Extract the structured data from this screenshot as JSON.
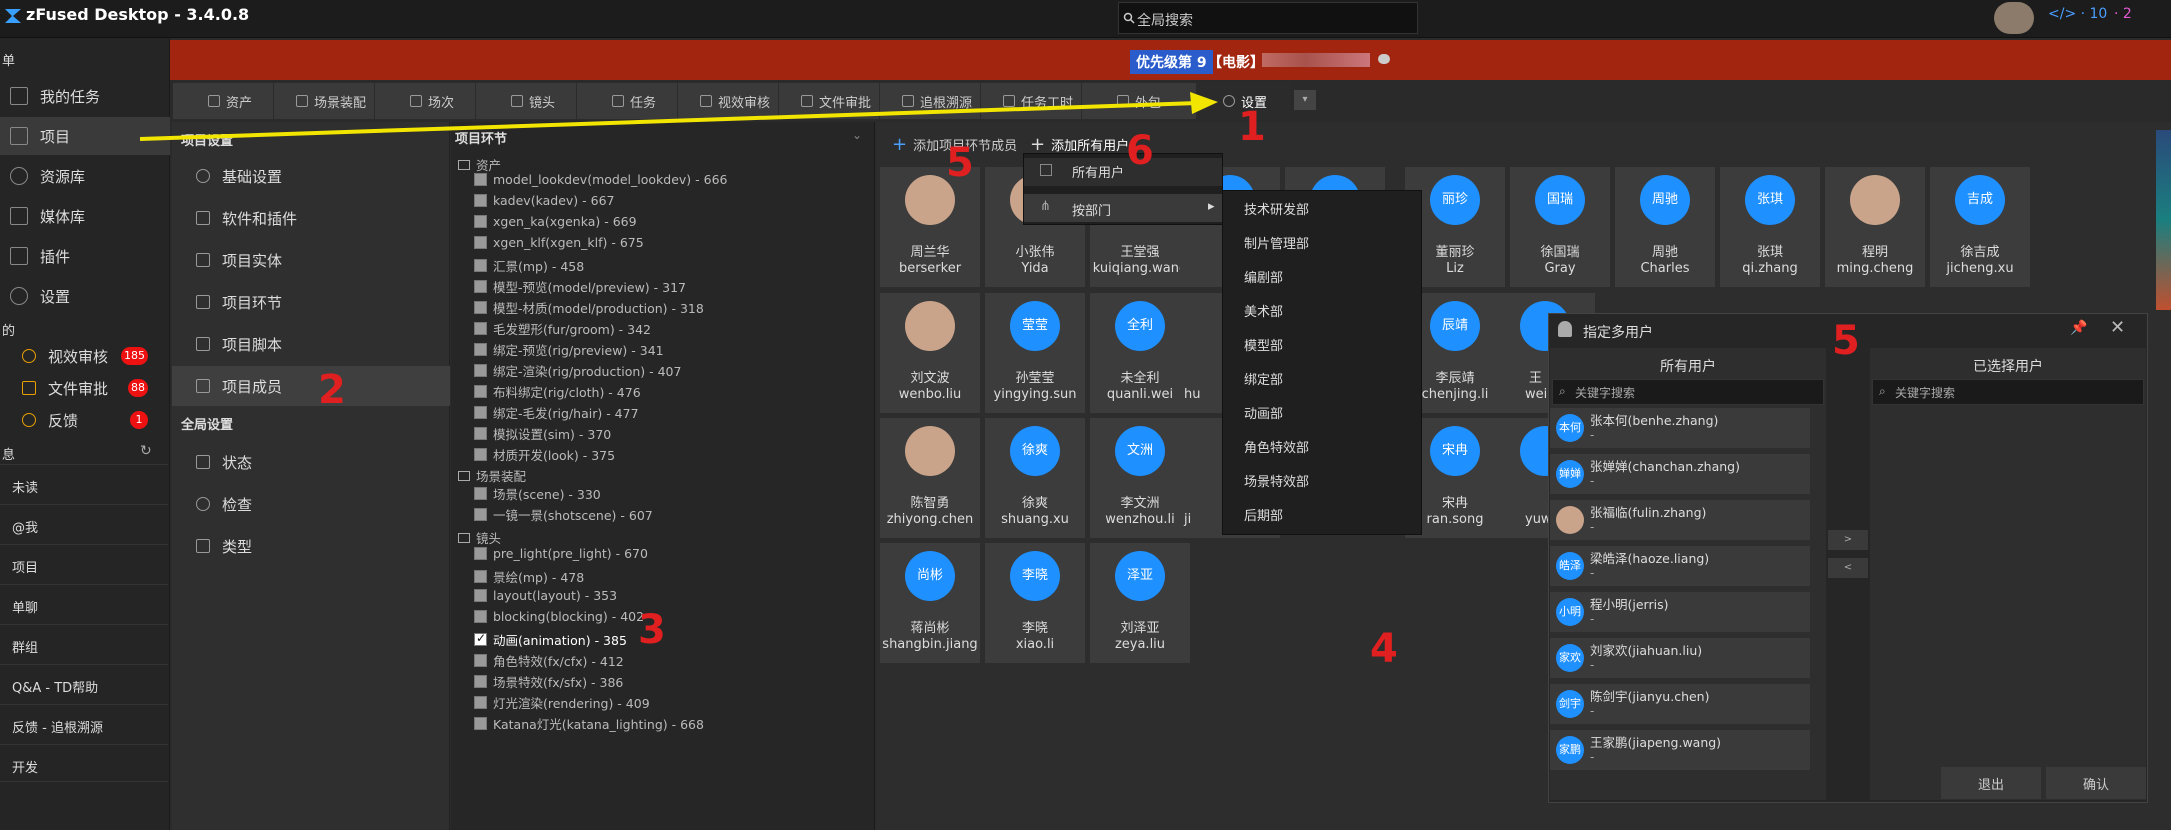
{
  "app": {
    "title": "zFused Desktop - 3.4.0.8",
    "search_placeholder": "全局搜索",
    "code_count": "</> · 10",
    "git_count": "· 2"
  },
  "banner": {
    "priority": "优先级第 9",
    "film_prefix": "【电影】"
  },
  "leftnav": {
    "section_menu": "单",
    "items": [
      {
        "label": "我的任务"
      },
      {
        "label": "项目"
      },
      {
        "label": "资源库"
      },
      {
        "label": "媒体库"
      },
      {
        "label": "插件"
      },
      {
        "label": "设置"
      }
    ],
    "section_mine": "的",
    "review": [
      {
        "label": "视效审核",
        "badge": "185"
      },
      {
        "label": "文件审批",
        "badge": "88"
      },
      {
        "label": "反馈",
        "badge": "1"
      }
    ],
    "section_msg": "息",
    "messages": [
      "未读",
      "@我",
      "项目",
      "单聊",
      "群组",
      "Q&A - TD帮助",
      "反馈 - 追根溯源",
      "开发"
    ]
  },
  "tabs": [
    "资产",
    "场景装配",
    "场次",
    "镜头",
    "任务",
    "视效审核",
    "文件审批",
    "追根溯源",
    "任务工时",
    "外包",
    "设置"
  ],
  "projcol": {
    "title": "项目设置",
    "items": [
      "基础设置",
      "软件和插件",
      "项目实体",
      "项目环节",
      "项目脚本",
      "项目成员"
    ],
    "global_title": "全局设置",
    "global_items": [
      "状态",
      "检查",
      "类型"
    ]
  },
  "steps": {
    "title": "项目环节",
    "group_asset": "资产",
    "asset_steps": [
      "model_lookdev(model_lookdev) - 666",
      "kadev(kadev) - 667",
      "xgen_ka(xgenka) - 669",
      "xgen_klf(xgen_klf) - 675",
      "汇景(mp) - 458",
      "模型-预览(model/preview) - 317",
      "模型-材质(model/production) - 318",
      "毛发塑形(fur/groom) - 342",
      "绑定-预览(rig/preview) - 341",
      "绑定-渲染(rig/production) - 407",
      "布料绑定(rig/cloth) - 476",
      "绑定-毛发(rig/hair) - 477",
      "模拟设置(sim) - 370",
      "材质开发(look) - 375"
    ],
    "group_scene": "场景装配",
    "scene_steps": [
      "场景(scene) - 330",
      "一镜一景(shotscene) - 607"
    ],
    "group_shot": "镜头",
    "shot_steps": [
      "pre_light(pre_light) - 670",
      "景绘(mp) - 478",
      "layout(layout) - 353",
      "blocking(blocking) - 402",
      "动画(animation) - 385",
      "角色特效(fx/cfx) - 412",
      "场景特效(fx/sfx) - 386",
      "灯光渲染(rendering) - 409",
      "Katana灯光(katana_lighting) - 668"
    ],
    "checked": "动画(animation) - 385"
  },
  "members_toolbar": {
    "add_step_member": "添加项目环节成员",
    "add_all_users": "添加所有用户"
  },
  "members": [
    {
      "cn": "周兰华",
      "en": "berserker",
      "avatar": "photo"
    },
    {
      "cn": "小张伟",
      "en": "Yida",
      "avatar": "photo"
    },
    {
      "cn": "王堂强",
      "en": "kuiqiang.wang",
      "avatar": "photo"
    },
    {
      "cn": "董丽珍",
      "en": "Liz",
      "avatar": "丽珍"
    },
    {
      "cn": "徐国瑞",
      "en": "Gray",
      "avatar": "国瑞"
    },
    {
      "cn": "周驰",
      "en": "Charles",
      "avatar": "周驰"
    },
    {
      "cn": "张琪",
      "en": "qi.zhang",
      "avatar": "张琪"
    },
    {
      "cn": "程明",
      "en": "ming.cheng",
      "avatar": "photo"
    },
    {
      "cn": "徐吉成",
      "en": "jicheng.xu",
      "avatar": "吉成"
    },
    {
      "cn": "刘文波",
      "en": "wenbo.liu",
      "avatar": "photo"
    },
    {
      "cn": "孙莹莹",
      "en": "yingying.sun",
      "avatar": "莹莹"
    },
    {
      "cn": "未全利",
      "en": "quanli.wei",
      "avatar": "全利"
    },
    {
      "cn": "李辰靖",
      "en": "chenjing.li",
      "avatar": "辰靖"
    },
    {
      "cn": "陈智勇",
      "en": "zhiyong.chen",
      "avatar": "photo"
    },
    {
      "cn": "徐爽",
      "en": "shuang.xu",
      "avatar": "徐爽"
    },
    {
      "cn": "李文洲",
      "en": "wenzhou.li",
      "avatar": "文洲"
    },
    {
      "cn": "宋冉",
      "en": "ran.song",
      "avatar": "宋冉"
    },
    {
      "cn": "蒋尚彬",
      "en": "shangbin.jiang",
      "avatar": "尚彬"
    },
    {
      "cn": "李晓",
      "en": "xiao.li",
      "avatar": "李晓"
    },
    {
      "cn": "刘泽亚",
      "en": "zeya.liu",
      "avatar": "泽亚"
    }
  ],
  "partial_names": [
    "hu",
    "wei",
    "ji",
    "yuw",
    "王"
  ],
  "ctx_menu": {
    "all_users": "所有用户",
    "by_dept": "按部门"
  },
  "departments": [
    "技术研发部",
    "制片管理部",
    "编剧部",
    "美术部",
    "模型部",
    "绑定部",
    "动画部",
    "角色特效部",
    "场景特效部",
    "后期部"
  ],
  "dialog": {
    "title": "指定多用户",
    "all_users": "所有用户",
    "selected_users": "已选择用户",
    "search_placeholder": "关键字搜索",
    "users": [
      {
        "name": "张本何(benhe.zhang)",
        "avatar": "本何",
        "dept": "-"
      },
      {
        "name": "张婵婵(chanchan.zhang)",
        "avatar": "婵婵",
        "dept": "-"
      },
      {
        "name": "张福临(fulin.zhang)",
        "avatar": "photo",
        "dept": "-"
      },
      {
        "name": "梁皓泽(haoze.liang)",
        "avatar": "皓泽",
        "dept": "-"
      },
      {
        "name": "程小明(jerris)",
        "avatar": "小明",
        "dept": "-"
      },
      {
        "name": "刘家欢(jiahuan.liu)",
        "avatar": "家欢",
        "dept": "-"
      },
      {
        "name": "陈剑宇(jianyu.chen)",
        "avatar": "剑宇",
        "dept": "-"
      },
      {
        "name": "王家鹏(jiapeng.wang)",
        "avatar": "家鹏",
        "dept": "-"
      }
    ],
    "exit": "退出",
    "confirm": "确认"
  },
  "annotations": [
    "1",
    "2",
    "3",
    "4",
    "5",
    "6",
    "5"
  ],
  "colors": {
    "accent_blue": "#1e90ff",
    "banner_red": "#a2260f",
    "arrow_yellow": "#f2e600",
    "annotation_red": "#e02020"
  }
}
